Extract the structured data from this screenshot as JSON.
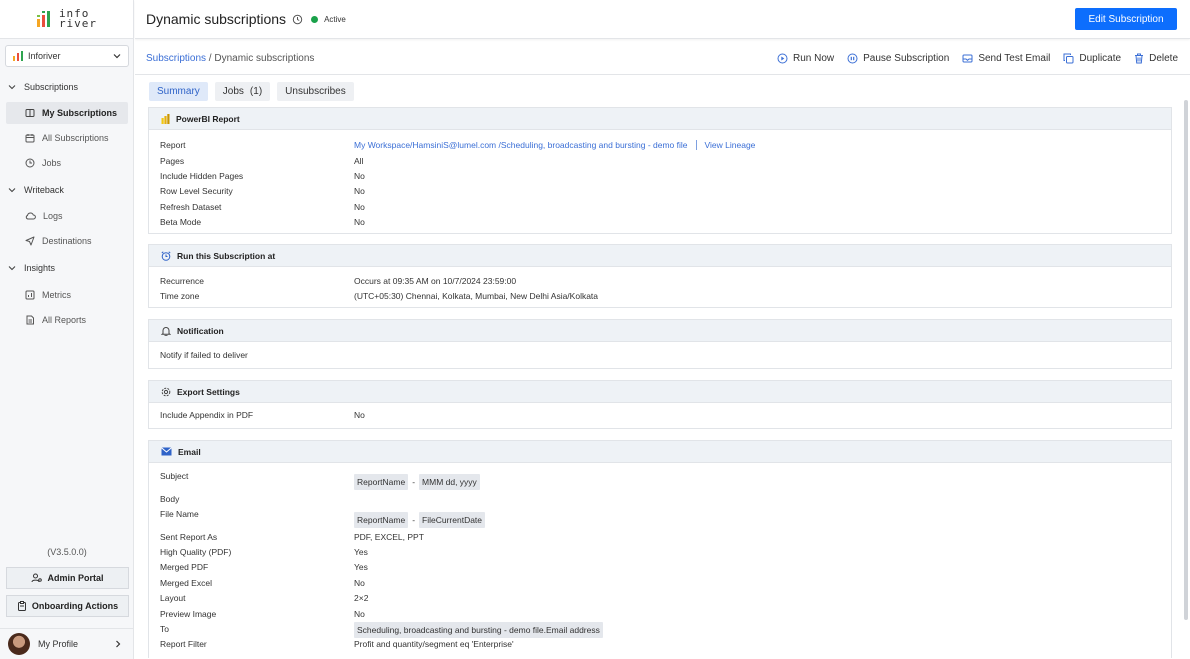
{
  "logo": {
    "line1": "info",
    "line2": "river"
  },
  "workspace": {
    "label": "Inforiver"
  },
  "sidebar": {
    "groups": [
      {
        "label": "Subscriptions",
        "items": [
          {
            "label": "My Subscriptions",
            "icon": "book-icon"
          },
          {
            "label": "All Subscriptions",
            "icon": "calendar-icon"
          },
          {
            "label": "Jobs",
            "icon": "clock-icon"
          }
        ]
      },
      {
        "label": "Writeback",
        "items": [
          {
            "label": "Logs",
            "icon": "cloud-icon"
          },
          {
            "label": "Destinations",
            "icon": "send-icon"
          }
        ]
      },
      {
        "label": "Insights",
        "items": [
          {
            "label": "Metrics",
            "icon": "chart-icon"
          },
          {
            "label": "All Reports",
            "icon": "file-icon"
          }
        ]
      }
    ],
    "version": "(V3.5.0.0)",
    "admin_portal": "Admin Portal",
    "onboarding_actions": "Onboarding Actions",
    "profile": "My Profile"
  },
  "header": {
    "title": "Dynamic subscriptions",
    "status": "Active",
    "edit_button": "Edit Subscription"
  },
  "breadcrumb": {
    "parent": "Subscriptions",
    "separator": " / ",
    "current": "Dynamic subscriptions"
  },
  "actions": {
    "run_now": "Run Now",
    "pause": "Pause Subscription",
    "send_test": "Send Test Email",
    "duplicate": "Duplicate",
    "delete": "Delete"
  },
  "tabs": {
    "summary": "Summary",
    "jobs": "Jobs",
    "jobs_count": "(1)",
    "unsubscribes": "Unsubscribes"
  },
  "powerbi": {
    "title": "PowerBI Report",
    "report_key": "Report",
    "report_value": "My Workspace/HamsiniS@lumel.com /Scheduling, broadcasting and bursting - demo file",
    "view_lineage": "View Lineage",
    "rows": [
      {
        "k": "Pages",
        "v": "All"
      },
      {
        "k": "Include Hidden Pages",
        "v": "No"
      },
      {
        "k": "Row Level Security",
        "v": "No"
      },
      {
        "k": "Refresh Dataset",
        "v": "No"
      },
      {
        "k": "Beta Mode",
        "v": "No"
      }
    ]
  },
  "schedule": {
    "title": "Run this Subscription at",
    "rows": [
      {
        "k": "Recurrence",
        "v": "Occurs at 09:35 AM on 10/7/2024 23:59:00"
      },
      {
        "k": "Time zone",
        "v": "(UTC+05:30) Chennai, Kolkata, Mumbai, New Delhi Asia/Kolkata"
      }
    ]
  },
  "notification": {
    "title": "Notification",
    "text": "Notify if failed to deliver"
  },
  "export": {
    "title": "Export Settings",
    "k": "Include Appendix in PDF",
    "v": "No"
  },
  "email": {
    "title": "Email",
    "subject_key": "Subject",
    "subject_chip1": "ReportName",
    "subject_dash": "-",
    "subject_chip2": "MMM dd, yyyy",
    "body_key": "Body",
    "filename_key": "File Name",
    "filename_chip1": "ReportName",
    "filename_dash": "-",
    "filename_chip2": "FileCurrentDate",
    "rows": [
      {
        "k": "Sent Report As",
        "v": "PDF, EXCEL, PPT"
      },
      {
        "k": "High Quality (PDF)",
        "v": "Yes"
      },
      {
        "k": "Merged PDF",
        "v": "Yes"
      },
      {
        "k": "Merged Excel",
        "v": "No"
      },
      {
        "k": "Layout",
        "v": "2×2"
      },
      {
        "k": "Preview Image",
        "v": "No"
      }
    ],
    "to_key": "To",
    "to_value": "Scheduling, broadcasting and bursting - demo file.Email address",
    "filter_key": "Report Filter",
    "filter_value": "Profit and quantity/segment eq 'Enterprise'"
  }
}
